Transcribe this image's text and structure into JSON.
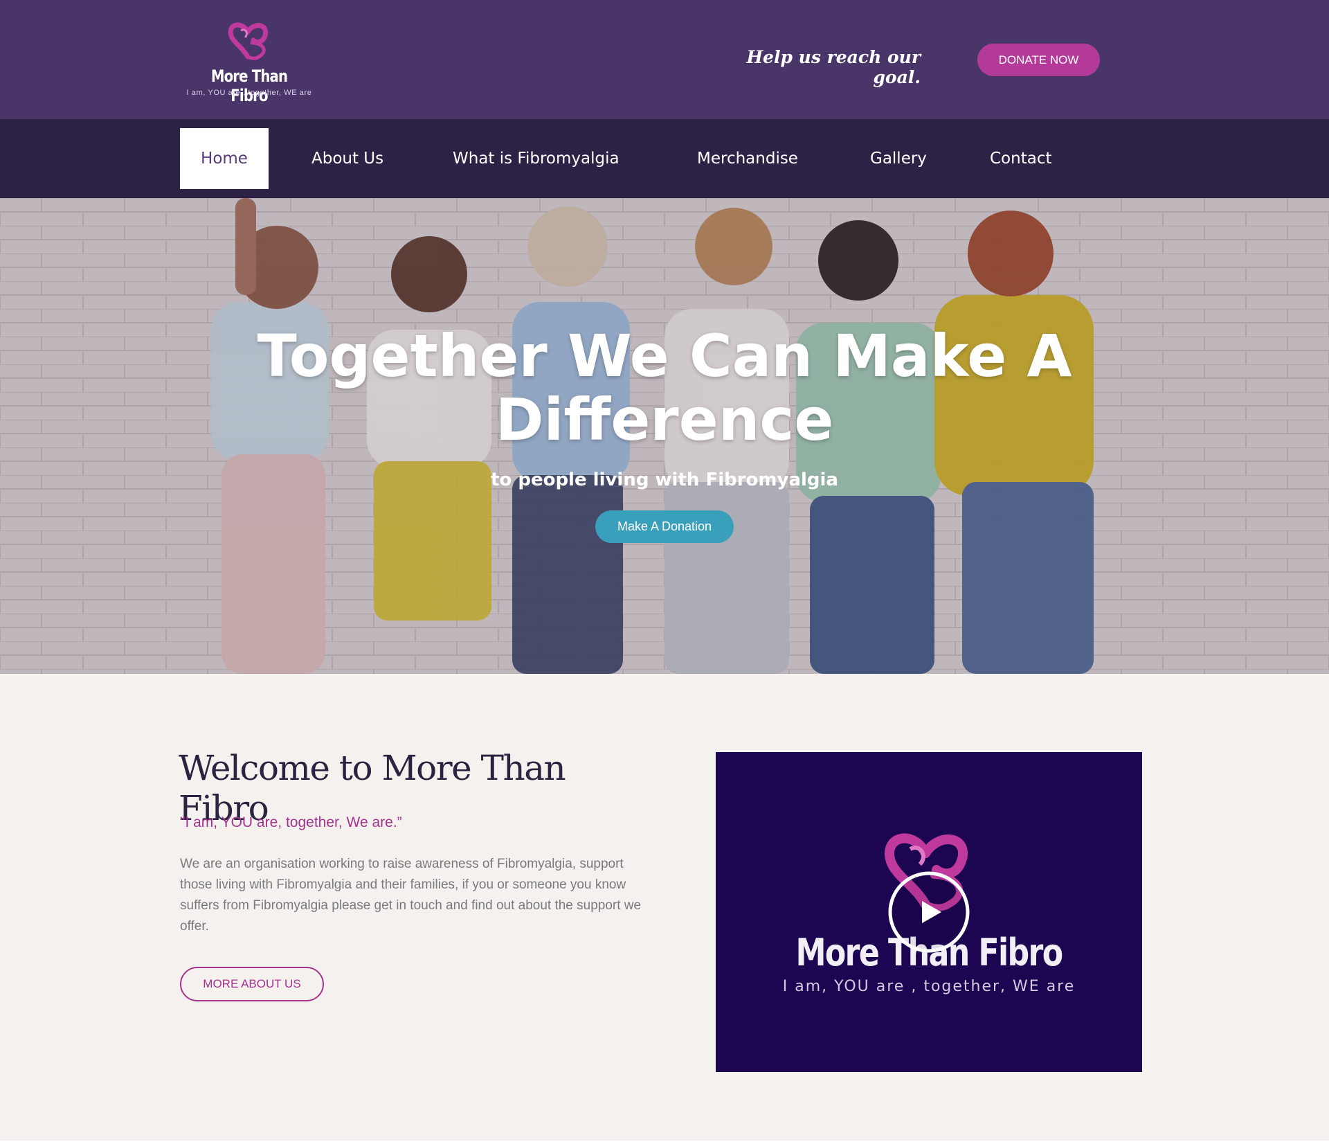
{
  "header": {
    "logo_name": "More Than Fibro",
    "logo_tagline": "I am, YOU are , together, WE are",
    "goal_text": "Help us reach our goal.",
    "donate_label": "DONATE NOW"
  },
  "nav": {
    "items": [
      {
        "label": "Home",
        "active": true
      },
      {
        "label": "About Us"
      },
      {
        "label": "What is Fibromyalgia"
      },
      {
        "label": "Merchandise"
      },
      {
        "label": "Gallery"
      },
      {
        "label": "Contact"
      }
    ]
  },
  "hero": {
    "title": "Together We Can Make A Difference",
    "subtitle": "to people living with Fibromyalgia",
    "button_label": "Make A Donation"
  },
  "welcome": {
    "title": "Welcome to More Than Fibro",
    "quote": "\"I am, YOU are, together, We are.”",
    "body": "We are an organisation working to raise awareness of Fibromyalgia, support those living with Fibromyalgia and their families, if you or someone you know suffers from Fibromyalgia please get in touch and find out about the support we offer.",
    "button_label": "MORE ABOUT US"
  },
  "video": {
    "name": "More Than Fibro",
    "tagline": "I am, YOU are , together, WE are",
    "play_icon": "play-icon"
  },
  "colors": {
    "header_bg": "#4a3569",
    "nav_bg": "#2d2145",
    "accent_magenta": "#b43a9a",
    "hero_button": "#3a9fba",
    "video_bg": "#1c0652"
  }
}
